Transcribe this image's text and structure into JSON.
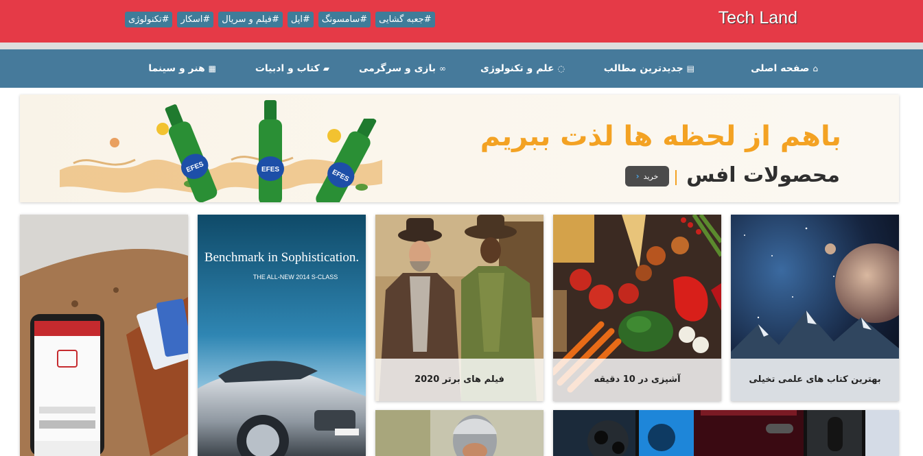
{
  "header": {
    "logo": "Tech Land",
    "tags": [
      "#تکنولوژی",
      "#اسکار",
      "#فیلم و سریال",
      "#اپل",
      "#سامسونگ",
      "#جعبه گشایی"
    ]
  },
  "nav": {
    "items": [
      {
        "label": "صفحه اصلی",
        "icon": "home-icon",
        "glyph": "⌂"
      },
      {
        "label": "جدیدترین مطالب",
        "icon": "newspaper-icon",
        "glyph": "▤"
      },
      {
        "label": "علم و تکنولوژی",
        "icon": "spinner-icon",
        "glyph": "◌"
      },
      {
        "label": "بازی و سرگرمی",
        "icon": "gamepad-icon",
        "glyph": "∞"
      },
      {
        "label": "کتاب و ادبیات",
        "icon": "book-icon",
        "glyph": "▰"
      },
      {
        "label": "هنر و سینما",
        "icon": "film-icon",
        "glyph": "▦"
      }
    ]
  },
  "banner": {
    "headline": "باهم از لحظه ها لذت ببریم",
    "product": "محصولات افس",
    "button": "خرید",
    "brand_on_bottle": "EFES"
  },
  "cards": [
    {
      "caption": "بهترین کتاب های علمی تخیلی",
      "image": "space-planet-image"
    },
    {
      "caption": "آشپزی در 10 دقیقه",
      "image": "vegetables-image"
    },
    {
      "caption": "فیلم های برتر 2020",
      "image": "django-movie-image"
    },
    {
      "caption": "",
      "image": "mercedes-ad-image",
      "ad_title": "Benchmark in Sophistication.",
      "ad_sub": "THE ALL-NEW 2014 S-CLASS"
    },
    {
      "caption": "",
      "image": "phone-wallet-image"
    },
    {
      "caption": "",
      "image": "helmet-rider-image"
    },
    {
      "caption": "",
      "image": "smartphones-image"
    }
  ],
  "colors": {
    "header_red": "#e53a47",
    "tag_blue": "#3f7c99",
    "nav_blue": "#467a9b",
    "banner_orange": "#f3a223"
  }
}
